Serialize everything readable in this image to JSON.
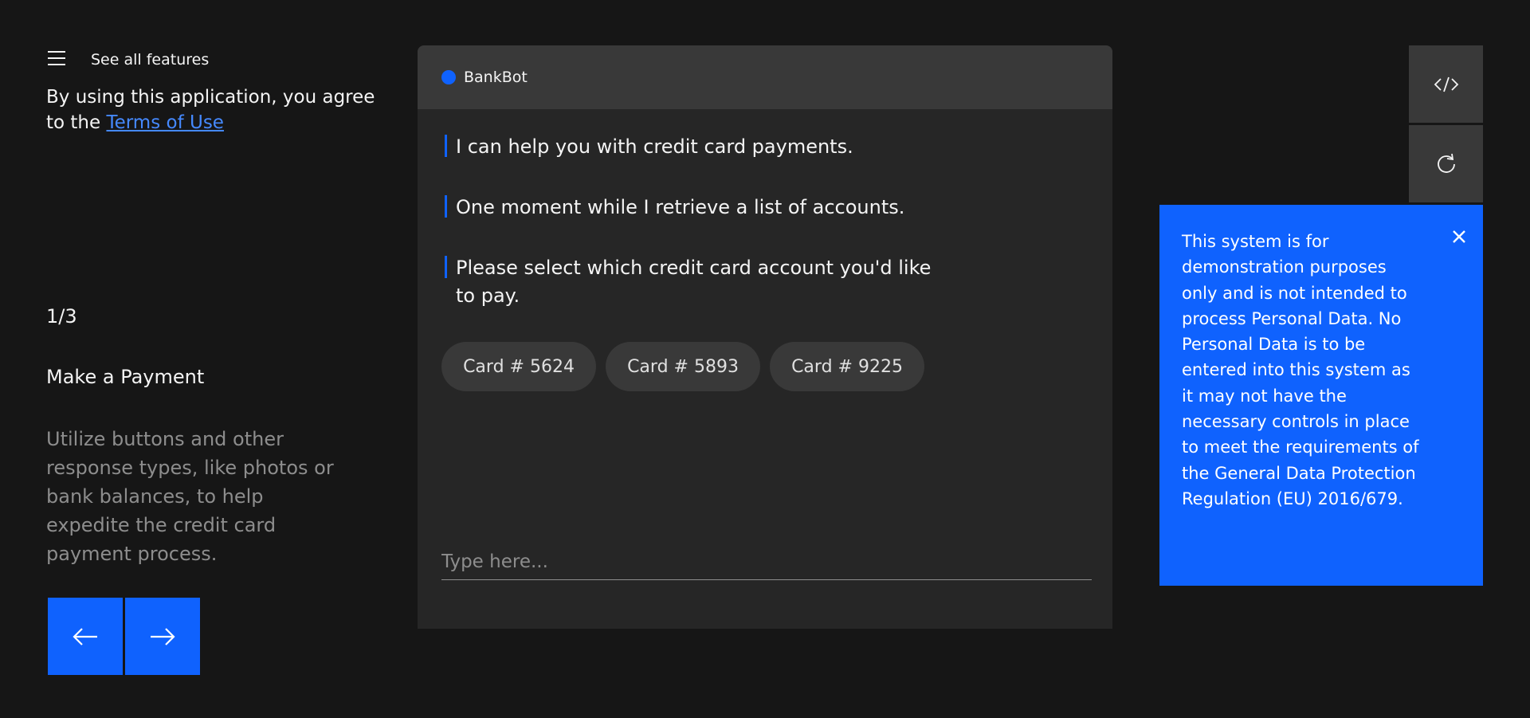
{
  "sidebar": {
    "menu_icon": "hamburger-menu-icon",
    "see_all": "See all features",
    "terms_prefix": "By using this application, you agree to the ",
    "terms_link": "Terms of Use",
    "counter": "1/3",
    "step_title": "Make a Payment",
    "step_description": "Utilize buttons and other response types, like photos or bank balances, to help expedite the credit card payment process.",
    "prev_icon": "arrow-left-icon",
    "next_icon": "arrow-right-icon"
  },
  "chat": {
    "bot_name": "BankBot",
    "status_color": "#0f62fe",
    "messages": [
      "I can help you with credit card payments.",
      "One moment while I retrieve a list of accounts.",
      "Please select which credit card account you'd like to pay."
    ],
    "options": [
      "Card # 5624",
      "Card # 5893",
      "Card # 9225"
    ],
    "input_placeholder": "Type here..."
  },
  "tools": {
    "code_icon": "code-icon",
    "refresh_icon": "refresh-icon"
  },
  "notice": {
    "text": "This system is for demonstration purposes only and is not intended to process Personal Data. No Personal Data is to be entered into this system as it may not have the necessary controls in place to meet the requirements of the General Data Protection Regulation (EU) 2016/679.",
    "close_icon": "close-icon",
    "background": "#0f62fe"
  },
  "theme": {
    "background": "#161616",
    "panel": "#262626",
    "header": "#393939",
    "accent": "#0f62fe",
    "link": "#4589ff"
  }
}
